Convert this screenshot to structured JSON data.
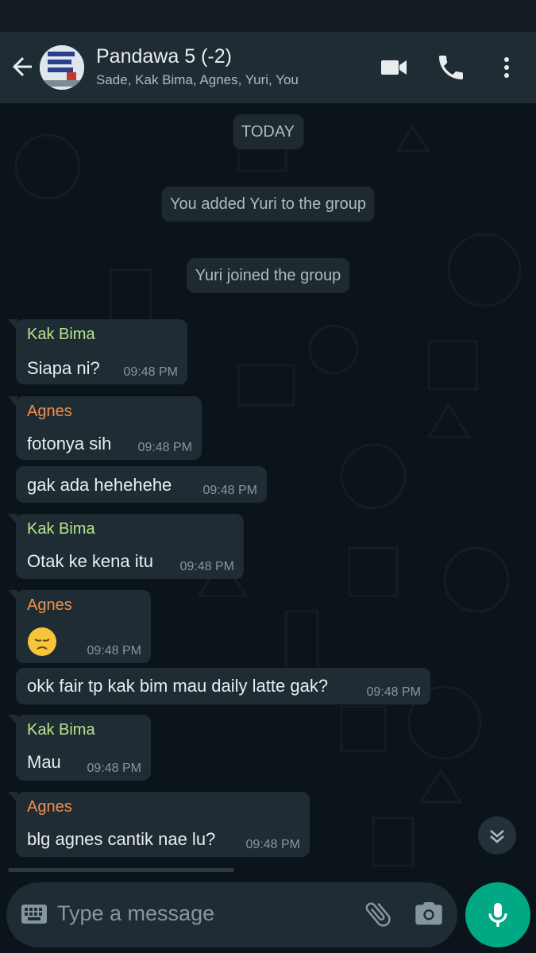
{
  "header": {
    "title": "Pandawa 5 (-2)",
    "subtitle": "Sade, Kak Bima, Agnes, Yuri, You",
    "icons": [
      "back-arrow-icon",
      "video-call-icon",
      "voice-call-icon",
      "more-options-icon"
    ]
  },
  "chat": {
    "date_label": "TODAY",
    "system_messages": [
      "You added Yuri to the group",
      "Yuri joined the group"
    ],
    "messages": [
      {
        "sender": "Kak Bima",
        "text": "Siapa ni?",
        "time": "09:48 PM"
      },
      {
        "sender": "Agnes",
        "text": "fotonya sih",
        "time": "09:48 PM"
      },
      {
        "sender": "",
        "text": "gak ada hehehehe",
        "time": "09:48 PM"
      },
      {
        "sender": "Kak Bima",
        "text": "Otak ke kena itu",
        "time": "09:48 PM"
      },
      {
        "sender": "Agnes",
        "text": "",
        "emoji": "pensive-face",
        "time": "09:48 PM"
      },
      {
        "sender": "",
        "text": "okk fair tp kak bim mau daily latte gak?",
        "time": "09:48 PM"
      },
      {
        "sender": "Kak Bima",
        "text": "Mau",
        "time": "09:48 PM"
      },
      {
        "sender": "Agnes",
        "text": "blg agnes cantik nae lu?",
        "time": "09:48 PM"
      }
    ]
  },
  "input": {
    "placeholder": "Type a message"
  },
  "colors": {
    "background": "#0b141a",
    "header": "#1f2c34",
    "bubble": "#1f2c34",
    "sender_kak_bima": "#b9e58c",
    "sender_agnes": "#f2904b",
    "accent": "#00a884"
  }
}
